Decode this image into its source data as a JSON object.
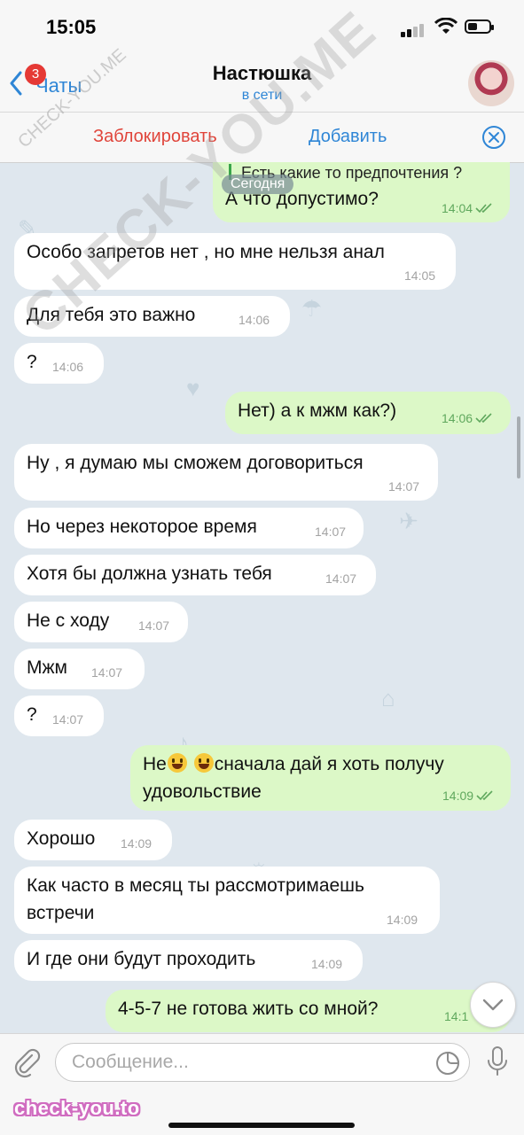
{
  "status_bar": {
    "time": "15:05"
  },
  "header": {
    "back_label": "Чаты",
    "unread_badge": "3",
    "title": "Настюшка",
    "status": "в сети"
  },
  "actions": {
    "block_label": "Заблокировать",
    "add_label": "Добавить"
  },
  "chat": {
    "date_label": "Сегодня",
    "reply_quote": "Есть какие то предпочтения ?",
    "messages": [
      {
        "dir": "out",
        "text": "А что допустимо?",
        "time": "14:04"
      },
      {
        "dir": "in",
        "text": "Особо запретов нет , но мне нельзя анал",
        "time": "14:05"
      },
      {
        "dir": "in",
        "text": "Для тебя это важно",
        "time": "14:06"
      },
      {
        "dir": "in",
        "text": "?",
        "time": "14:06"
      },
      {
        "dir": "out",
        "text": "Нет) а к мжм как?)",
        "time": "14:06"
      },
      {
        "dir": "in",
        "text": "Ну , я думаю мы сможем договориться",
        "time": "14:07"
      },
      {
        "dir": "in",
        "text": "Но через некоторое время",
        "time": "14:07"
      },
      {
        "dir": "in",
        "text": "Хотя бы должна узнать тебя",
        "time": "14:07"
      },
      {
        "dir": "in",
        "text": "Не с ходу",
        "time": "14:07"
      },
      {
        "dir": "in",
        "text": "Мжм",
        "time": "14:07"
      },
      {
        "dir": "in",
        "text": "?",
        "time": "14:07"
      },
      {
        "dir": "out",
        "text_before": "Не",
        "text_after": "сначала дай я хоть получу",
        "text_line2": "удовольствие",
        "time": "14:09"
      },
      {
        "dir": "in",
        "text": "Хорошо",
        "time": "14:09"
      },
      {
        "dir": "in",
        "text": "Как часто в месяц ты рассмотримаешь\nвстречи",
        "time": "14:09"
      },
      {
        "dir": "in",
        "text": "И где они будут проходить",
        "time": "14:09"
      },
      {
        "dir": "out",
        "text": "4-5-7 не готова жить со мной?",
        "time": "14:1"
      }
    ]
  },
  "input": {
    "placeholder": "Сообщение..."
  },
  "watermark": {
    "main": "CHECK-YOU.ME",
    "small": "CHECK-YOU.ME",
    "brand": "check-you.to"
  },
  "colors": {
    "accent": "#2f86d6",
    "danger": "#e0453b",
    "out_bubble": "#dcf8c7",
    "in_bubble": "#ffffff",
    "badge": "#e53935"
  },
  "icons": [
    "back-chevron-icon",
    "signal-icon",
    "wifi-icon",
    "battery-icon",
    "close-circle-icon",
    "checkmarks-icon",
    "paperclip-icon",
    "sticker-icon",
    "microphone-icon",
    "chevron-down-icon",
    "grinning-emoji-icon",
    "smiling-emoji-icon"
  ]
}
